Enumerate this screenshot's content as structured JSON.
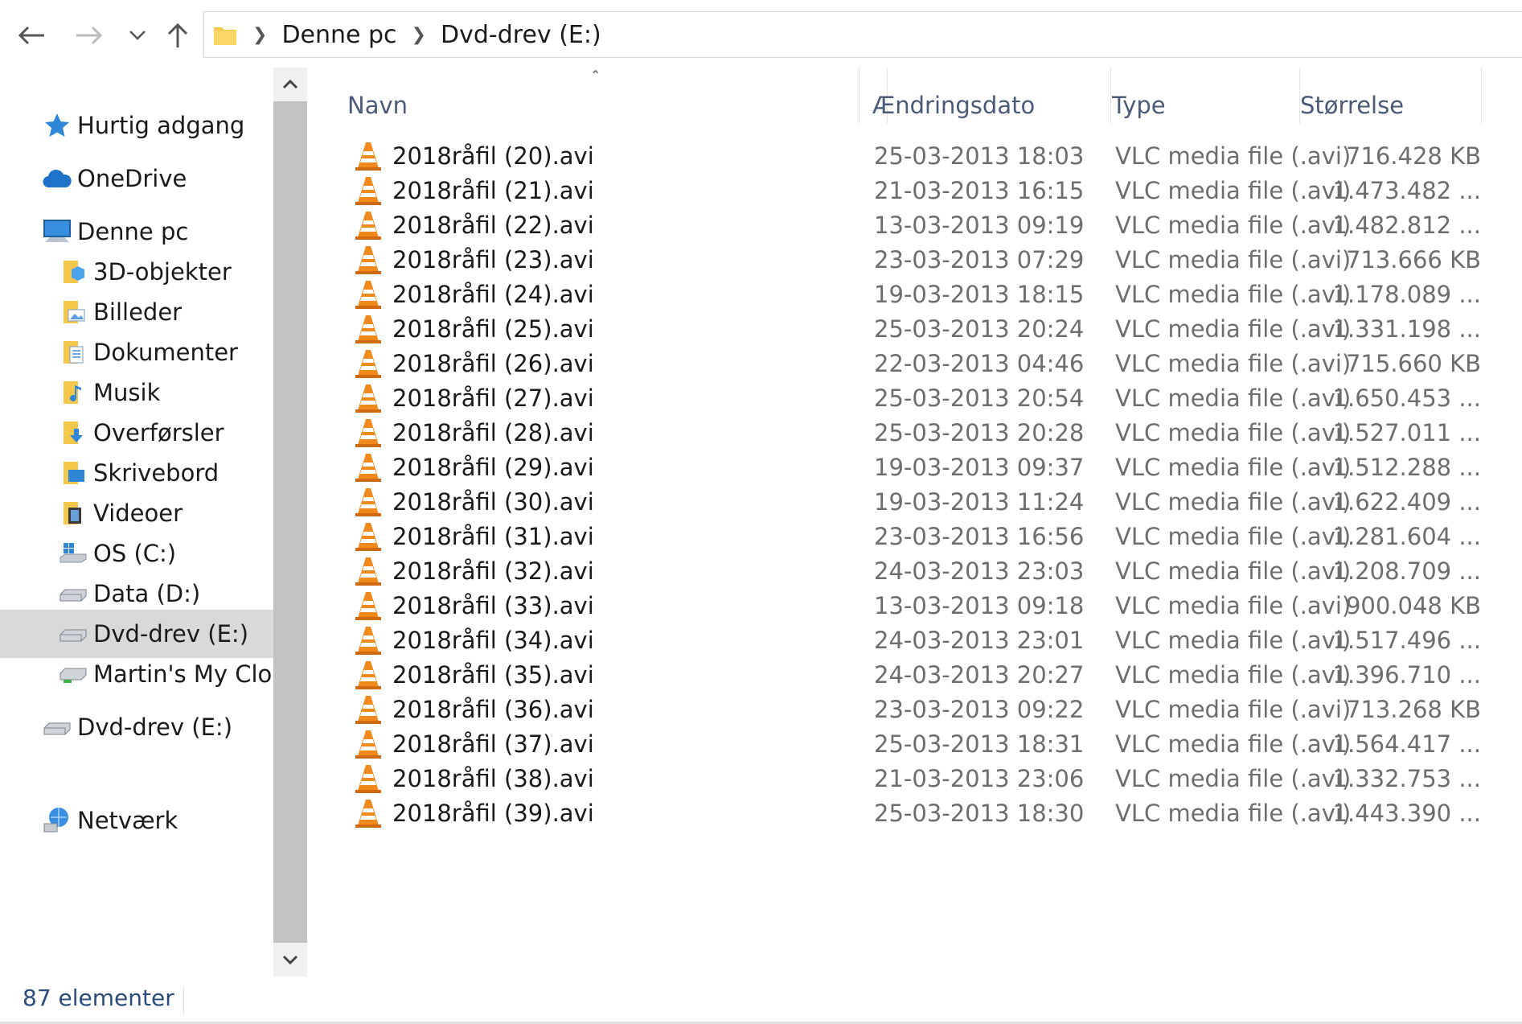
{
  "toolbar": {
    "back_icon": "arrow-left-icon",
    "forward_icon": "arrow-right-icon",
    "recent_icon": "chevron-down-icon",
    "up_icon": "arrow-up-icon"
  },
  "address": {
    "crumbs": [
      "Denne pc",
      "Dvd-drev (E:)"
    ]
  },
  "nav": {
    "items": [
      {
        "label": "Hurtig adgang",
        "icon": "star-icon"
      },
      {
        "label": "OneDrive",
        "icon": "cloud-icon"
      },
      {
        "label": "Denne pc",
        "icon": "computer-icon"
      },
      {
        "label": "3D-objekter",
        "icon": "folder-3d-icon"
      },
      {
        "label": "Billeder",
        "icon": "folder-pictures-icon"
      },
      {
        "label": "Dokumenter",
        "icon": "folder-documents-icon"
      },
      {
        "label": "Musik",
        "icon": "folder-music-icon"
      },
      {
        "label": "Overførsler",
        "icon": "folder-downloads-icon"
      },
      {
        "label": "Skrivebord",
        "icon": "folder-desktop-icon"
      },
      {
        "label": "Videoer",
        "icon": "folder-videos-icon"
      },
      {
        "label": "OS (C:)",
        "icon": "windows-drive-icon"
      },
      {
        "label": "Data (D:)",
        "icon": "drive-icon"
      },
      {
        "label": "Dvd-drev (E:)",
        "icon": "drive-icon",
        "selected": true
      },
      {
        "label": "Martin's My Clou",
        "icon": "network-drive-icon"
      },
      {
        "label": "Dvd-drev (E:)",
        "icon": "drive-icon"
      },
      {
        "label": "Netværk",
        "icon": "network-icon"
      }
    ]
  },
  "columns": {
    "name": "Navn",
    "date": "Ændringsdato",
    "type": "Type",
    "size": "Størrelse"
  },
  "files": [
    {
      "name": "2018råfil (20).avi",
      "date": "25-03-2013 18:03",
      "type": "VLC media file (.avi)",
      "size": "716.428 KB"
    },
    {
      "name": "2018råfil (21).avi",
      "date": "21-03-2013 16:15",
      "type": "VLC media file (.avi)",
      "size": "1.473.482 ..."
    },
    {
      "name": "2018råfil (22).avi",
      "date": "13-03-2013 09:19",
      "type": "VLC media file (.avi)",
      "size": "1.482.812 ..."
    },
    {
      "name": "2018råfil (23).avi",
      "date": "23-03-2013 07:29",
      "type": "VLC media file (.avi)",
      "size": "713.666 KB"
    },
    {
      "name": "2018råfil (24).avi",
      "date": "19-03-2013 18:15",
      "type": "VLC media file (.avi)",
      "size": "1.178.089 ..."
    },
    {
      "name": "2018råfil (25).avi",
      "date": "25-03-2013 20:24",
      "type": "VLC media file (.avi)",
      "size": "1.331.198 ..."
    },
    {
      "name": "2018råfil (26).avi",
      "date": "22-03-2013 04:46",
      "type": "VLC media file (.avi)",
      "size": "715.660 KB"
    },
    {
      "name": "2018råfil (27).avi",
      "date": "25-03-2013 20:54",
      "type": "VLC media file (.avi)",
      "size": "1.650.453 ..."
    },
    {
      "name": "2018råfil (28).avi",
      "date": "25-03-2013 20:28",
      "type": "VLC media file (.avi)",
      "size": "1.527.011 ..."
    },
    {
      "name": "2018råfil (29).avi",
      "date": "19-03-2013 09:37",
      "type": "VLC media file (.avi)",
      "size": "1.512.288 ..."
    },
    {
      "name": "2018råfil (30).avi",
      "date": "19-03-2013 11:24",
      "type": "VLC media file (.avi)",
      "size": "1.622.409 ..."
    },
    {
      "name": "2018råfil (31).avi",
      "date": "23-03-2013 16:56",
      "type": "VLC media file (.avi)",
      "size": "1.281.604 ..."
    },
    {
      "name": "2018råfil (32).avi",
      "date": "24-03-2013 23:03",
      "type": "VLC media file (.avi)",
      "size": "1.208.709 ..."
    },
    {
      "name": "2018råfil (33).avi",
      "date": "13-03-2013 09:18",
      "type": "VLC media file (.avi)",
      "size": "900.048 KB"
    },
    {
      "name": "2018råfil (34).avi",
      "date": "24-03-2013 23:01",
      "type": "VLC media file (.avi)",
      "size": "1.517.496 ..."
    },
    {
      "name": "2018råfil (35).avi",
      "date": "24-03-2013 20:27",
      "type": "VLC media file (.avi)",
      "size": "1.396.710 ..."
    },
    {
      "name": "2018råfil (36).avi",
      "date": "23-03-2013 09:22",
      "type": "VLC media file (.avi)",
      "size": "713.268 KB"
    },
    {
      "name": "2018råfil (37).avi",
      "date": "25-03-2013 18:31",
      "type": "VLC media file (.avi)",
      "size": "1.564.417 ..."
    },
    {
      "name": "2018råfil (38).avi",
      "date": "21-03-2013 23:06",
      "type": "VLC media file (.avi)",
      "size": "1.332.753 ..."
    },
    {
      "name": "2018råfil (39).avi",
      "date": "25-03-2013 18:30",
      "type": "VLC media file (.avi)",
      "size": "1.443.390 ..."
    }
  ],
  "status": {
    "count": "87 elementer"
  },
  "colors": {
    "selected_bg": "#d9d9d9",
    "header_text": "#4a5a78",
    "secondary_text": "#6d6d6d",
    "vlc_orange": "#f08a1c"
  }
}
